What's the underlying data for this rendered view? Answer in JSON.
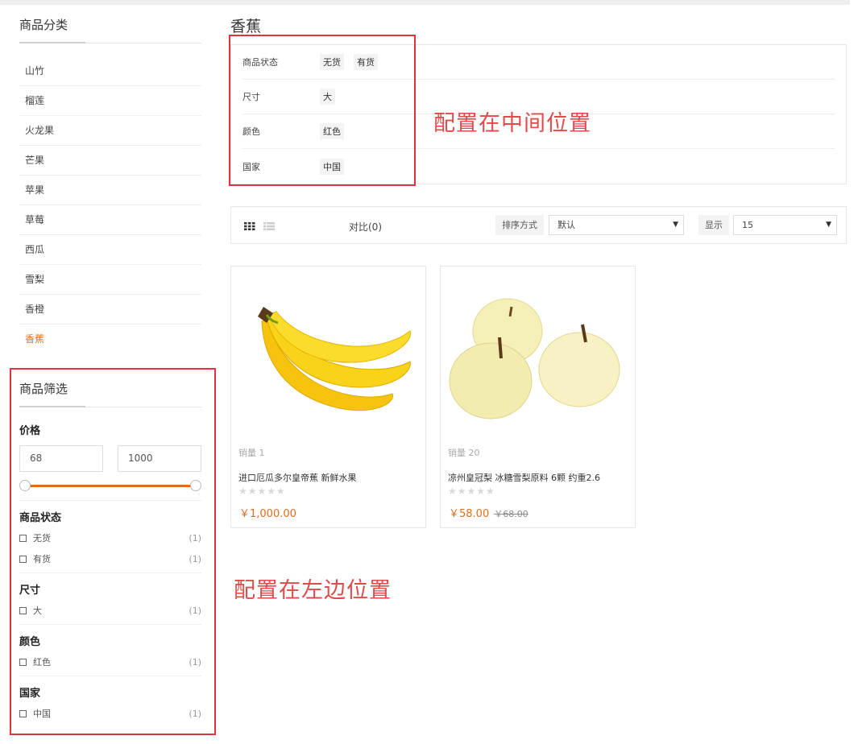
{
  "sidebar": {
    "category_title": "商品分类",
    "categories": [
      "山竹",
      "榴莲",
      "火龙果",
      "芒果",
      "苹果",
      "草莓",
      "西瓜",
      "雪梨",
      "香橙",
      "香蕉"
    ],
    "active_category": "香蕉"
  },
  "filter": {
    "title": "商品筛选",
    "price": {
      "label": "价格",
      "min": "68",
      "max": "1000"
    },
    "groups": [
      {
        "title": "商品状态",
        "options": [
          {
            "label": "无货",
            "count": "(1)"
          },
          {
            "label": "有货",
            "count": "(1)"
          }
        ]
      },
      {
        "title": "尺寸",
        "options": [
          {
            "label": "大",
            "count": "(1)"
          }
        ]
      },
      {
        "title": "颜色",
        "options": [
          {
            "label": "红色",
            "count": "(1)"
          }
        ]
      },
      {
        "title": "国家",
        "options": [
          {
            "label": "中国",
            "count": "(1)"
          }
        ]
      }
    ]
  },
  "main": {
    "title": "香蕉",
    "attributes": [
      {
        "name": "商品状态",
        "values": [
          "无货",
          "有货"
        ]
      },
      {
        "name": "尺寸",
        "values": [
          "大"
        ]
      },
      {
        "name": "颜色",
        "values": [
          "红色"
        ]
      },
      {
        "name": "国家",
        "values": [
          "中国"
        ]
      }
    ],
    "annotation_middle": "配置在中间位置",
    "annotation_left": "配置在左边位置"
  },
  "toolbar": {
    "compare": "对比(0)",
    "sort_label": "排序方式",
    "sort_value": "默认",
    "show_label": "显示",
    "show_value": "15",
    "select_arrow": "▼"
  },
  "products": [
    {
      "sales": "销量 1",
      "name": "进口厄瓜多尔皇帝蕉 新鲜水果",
      "stars": "★★★★★",
      "price": "￥1,000.00",
      "old_price": "",
      "image": "banana-image"
    },
    {
      "sales": "销量 20",
      "name": "凉州皇冠梨 冰糖雪梨原料 6颗 约重2.6",
      "stars": "★★★★★",
      "price": "￥58.00",
      "old_price": "￥68.00",
      "image": "pear-image"
    }
  ],
  "colors": {
    "accent": "#e36c1c",
    "annotation": "#e04a4a",
    "highlight_box": "#d9363e"
  }
}
